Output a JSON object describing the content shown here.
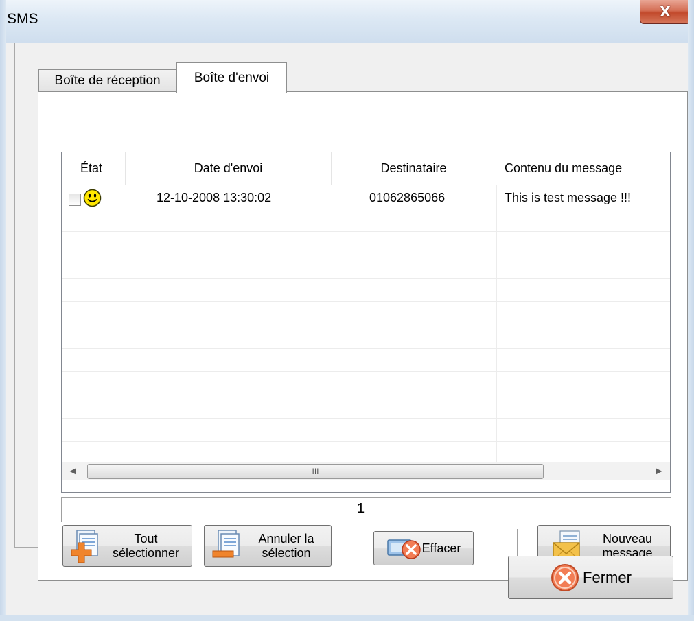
{
  "window": {
    "title": "SMS",
    "close_glyph": "X"
  },
  "tabs": [
    {
      "label": "Boîte de réception",
      "active": false
    },
    {
      "label": "Boîte d'envoi",
      "active": true
    }
  ],
  "list": {
    "columns": [
      "État",
      "Date d'envoi",
      "Destinataire",
      "Contenu du message"
    ],
    "rows": [
      {
        "checked": false,
        "status_icon": "smiley-icon",
        "date": "12-10-2008  13:30:02",
        "recipient": "01062865066",
        "content": "This is test message !!!"
      }
    ],
    "scrollbar_grip": "III",
    "scroll_left": "◀",
    "scroll_right": "▶"
  },
  "status": {
    "count": "1"
  },
  "buttons": {
    "select_all": "Tout\nsélectionner",
    "select_all_line1": "Tout",
    "select_all_line2": "sélectionner",
    "cancel_sel_line1": "Annuler la",
    "cancel_sel_line2": "sélection",
    "delete": "Effacer",
    "new_msg_line1": "Nouveau",
    "new_msg_line2": "message",
    "close": "Fermer"
  },
  "colors": {
    "close_red": "#c24a2c",
    "smiley_yellow": "#ffe600"
  }
}
